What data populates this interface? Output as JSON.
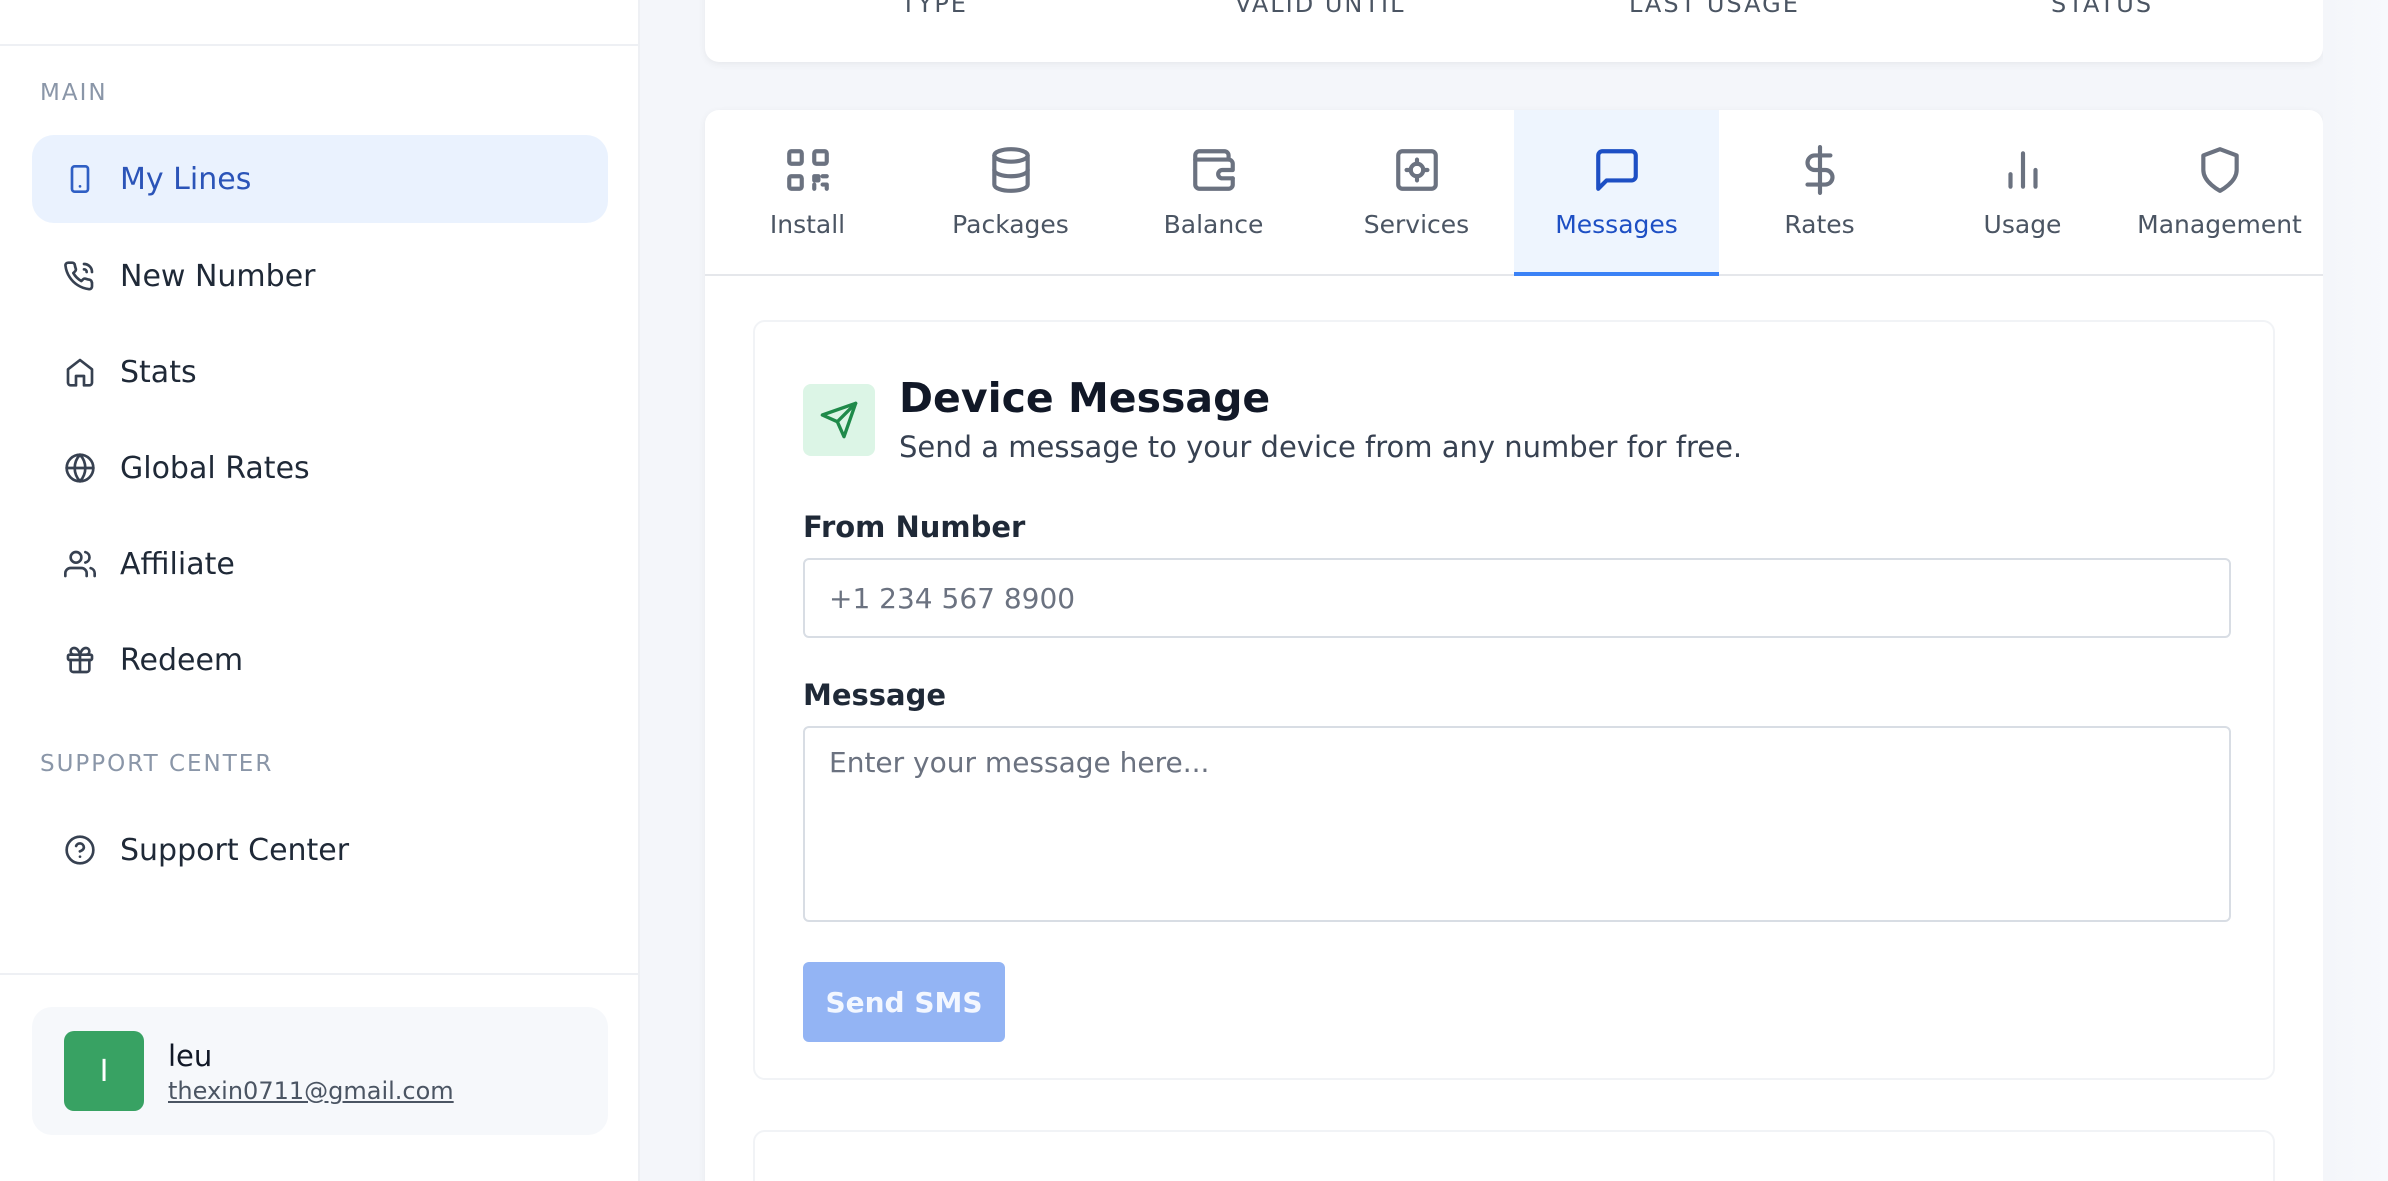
{
  "sidebar": {
    "main_label": "MAIN",
    "support_label": "SUPPORT CENTER",
    "items": [
      {
        "label": "My Lines",
        "icon": "smartphone-icon",
        "active": true
      },
      {
        "label": "New Number",
        "icon": "phone-call-icon"
      },
      {
        "label": "Stats",
        "icon": "home-icon"
      },
      {
        "label": "Global Rates",
        "icon": "globe-icon"
      },
      {
        "label": "Affiliate",
        "icon": "users-icon"
      },
      {
        "label": "Redeem",
        "icon": "gift-icon"
      }
    ],
    "support_items": [
      {
        "label": "Support Center",
        "icon": "help-circle-icon"
      }
    ],
    "user": {
      "initial": "I",
      "name": "leu",
      "email": "thexin0711@gmail.com",
      "avatar_color": "#38a263"
    }
  },
  "top_table": {
    "columns": [
      "TYPE",
      "VALID UNTIL",
      "LAST USAGE",
      "STATUS"
    ]
  },
  "tabs": [
    {
      "label": "Install",
      "icon": "qr-code-icon"
    },
    {
      "label": "Packages",
      "icon": "database-icon"
    },
    {
      "label": "Balance",
      "icon": "wallet-icon"
    },
    {
      "label": "Services",
      "icon": "settings-box-icon"
    },
    {
      "label": "Messages",
      "icon": "message-square-icon",
      "active": true
    },
    {
      "label": "Rates",
      "icon": "dollar-icon"
    },
    {
      "label": "Usage",
      "icon": "bar-chart-icon"
    },
    {
      "label": "Management",
      "icon": "shield-icon"
    }
  ],
  "device_message": {
    "title": "Device Message",
    "subtitle": "Send a message to your device from any number for free.",
    "from_label": "From Number",
    "from_placeholder": "+1 234 567 8900",
    "message_label": "Message",
    "message_placeholder": "Enter your message here...",
    "send_label": "Send SMS"
  },
  "colors": {
    "accent": "#3b82f6",
    "active_nav_bg": "#eaf2fe",
    "send_button": "#93b4f4"
  }
}
